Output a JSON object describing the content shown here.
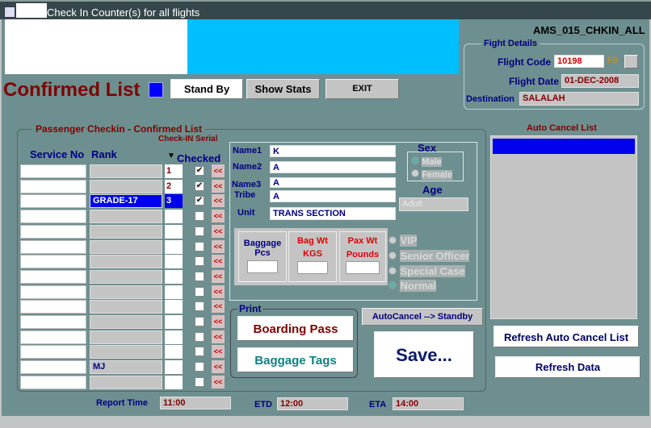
{
  "window": {
    "title": "Check In Counter(s) for all flights",
    "form_id": "AMS_015_CHKIN_ALL"
  },
  "header": {
    "list_title": "Confirmed List",
    "standby_label": "Stand By",
    "stats_label": "Show Stats",
    "exit_label": "EXIT"
  },
  "flight": {
    "group_label": "Fight Details",
    "code_label": "Flight Code",
    "code": "10198",
    "lov_label": "F9",
    "date_label": "Flight Date",
    "date": "01-DEC-2008",
    "dest_label": "Destination",
    "dest": "SALALAH"
  },
  "list": {
    "group_label": "Passenger  Checkin - Confirmed List",
    "serial_label": "Check-IN Serial",
    "col_service": "Service No",
    "col_rank": "Rank",
    "col_checked": "Checked",
    "remove_label": "<<",
    "rows": [
      {
        "rank": "",
        "serial": "1",
        "checked": true
      },
      {
        "rank": "",
        "serial": "2",
        "checked": true
      },
      {
        "rank": "GRADE-17",
        "serial": "3",
        "checked": true,
        "selected": true
      },
      {
        "rank": "",
        "serial": "",
        "checked": false
      },
      {
        "rank": "",
        "serial": "",
        "checked": false
      },
      {
        "rank": "",
        "serial": "",
        "checked": false
      },
      {
        "rank": "",
        "serial": "",
        "checked": false
      },
      {
        "rank": "",
        "serial": "",
        "checked": false
      },
      {
        "rank": "",
        "serial": "",
        "checked": false
      },
      {
        "rank": "",
        "serial": "",
        "checked": false
      },
      {
        "rank": "",
        "serial": "",
        "checked": false
      },
      {
        "rank": "",
        "serial": "",
        "checked": false
      },
      {
        "rank": "",
        "serial": "",
        "checked": false
      },
      {
        "rank": "MJ",
        "serial": "",
        "checked": false
      },
      {
        "rank": "",
        "serial": "",
        "checked": false
      }
    ]
  },
  "passenger": {
    "name1_label": "Name1",
    "name1": "K",
    "name2_label": "Name2",
    "name2": "A",
    "name3_label": "Name3",
    "name3": "A",
    "tribe_label": "Tribe",
    "tribe": "A",
    "unit_label": "Unit",
    "unit": "TRANS SECTION",
    "sex_label": "Sex",
    "male": "Male",
    "female": "Female",
    "age_label": "Age",
    "age": "Adult",
    "bag_pcs_label1": "Baggage",
    "bag_pcs_label2": "Pcs",
    "bag_wt_label1": "Bag Wt",
    "bag_wt_label2": "KGS",
    "pax_wt_label1": "Pax Wt",
    "pax_wt_label2": "Pounds",
    "vip": "VIP",
    "senior": "Senior Officer",
    "special": "Special Case",
    "normal": "Normal"
  },
  "print": {
    "group_label": "Print",
    "boarding": "Boarding Pass",
    "tags": "Baggage Tags"
  },
  "actions": {
    "autocancel": "AutoCancel --> Standby",
    "save": "Save...",
    "refresh_auto": "Refresh Auto Cancel List",
    "refresh_data": "Refresh Data"
  },
  "autocancel": {
    "title": "Auto Cancel List"
  },
  "footer": {
    "report_label": "Report Time",
    "report": "11:00",
    "etd_label": "ETD",
    "etd": "12:00",
    "eta_label": "ETA",
    "eta": "14:00"
  }
}
